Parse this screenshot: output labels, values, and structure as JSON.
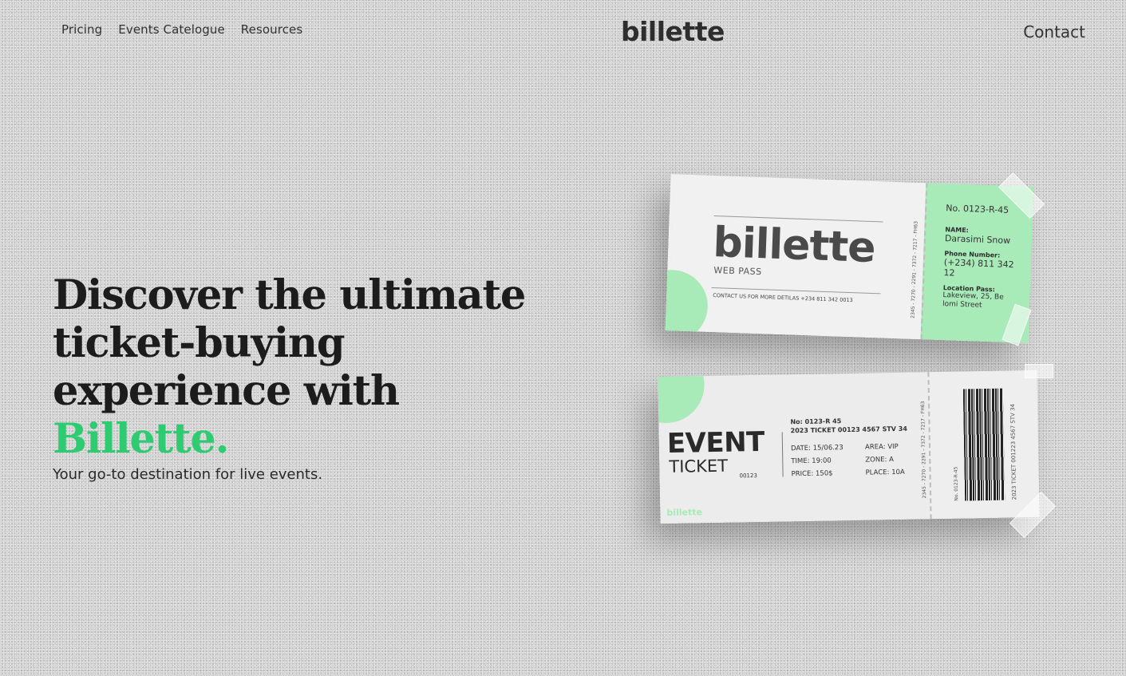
{
  "nav": {
    "links": [
      "Pricing",
      "Events Catelogue",
      "Resources"
    ]
  },
  "header": {
    "logo": "billette",
    "contact": "Contact"
  },
  "hero": {
    "title_line1": "Discover the ultimate",
    "title_line2": "ticket-buying",
    "title_line3": "experience with",
    "title_brand": "Billette.",
    "subtitle": "Your go-to destination for live events."
  },
  "web_pass": {
    "logo": "billette",
    "subtitle": "WEB PASS",
    "contact_line": "CONTACT US FOR MORE DETILAS +234 811 342 0013",
    "side_code": "2345 - 7270 - 2291 - 7372 - 7217 - FH63",
    "number": "No. 0123-R-45",
    "name_label": "NAME:",
    "name_value": "Darasimi Snow",
    "phone_label": "Phone Number:",
    "phone_value": "(+234) 811 342 12",
    "location_label": "Location Pass:",
    "location_value": "Lakeview, 25, Be lomi Street"
  },
  "event_ticket": {
    "title": "EVENT",
    "subtitle": "TICKET",
    "number_small": "00123",
    "no_line": "No: 0123-R 45",
    "ticket_line": "2023 TICKET 00123 4567 STV 34",
    "date": "DATE: 15/06.23",
    "time": "TIME: 19:00",
    "price": "PRICE: 150$",
    "area": "AREA: VIP",
    "zone": "ZONE: A",
    "place": "PLACE: 10A",
    "brand": "billette",
    "side_code": "2345 - 7270 - 2291 - 7372 - 7217 - FH63",
    "stub_no": "No. 0123-R-45",
    "stub_ticket": "2023 TICKET 001223 4567 STV 34"
  },
  "colors": {
    "accent": "#2ecc71",
    "ticket_green": "#a8eab8",
    "text": "#1c1c1c"
  }
}
